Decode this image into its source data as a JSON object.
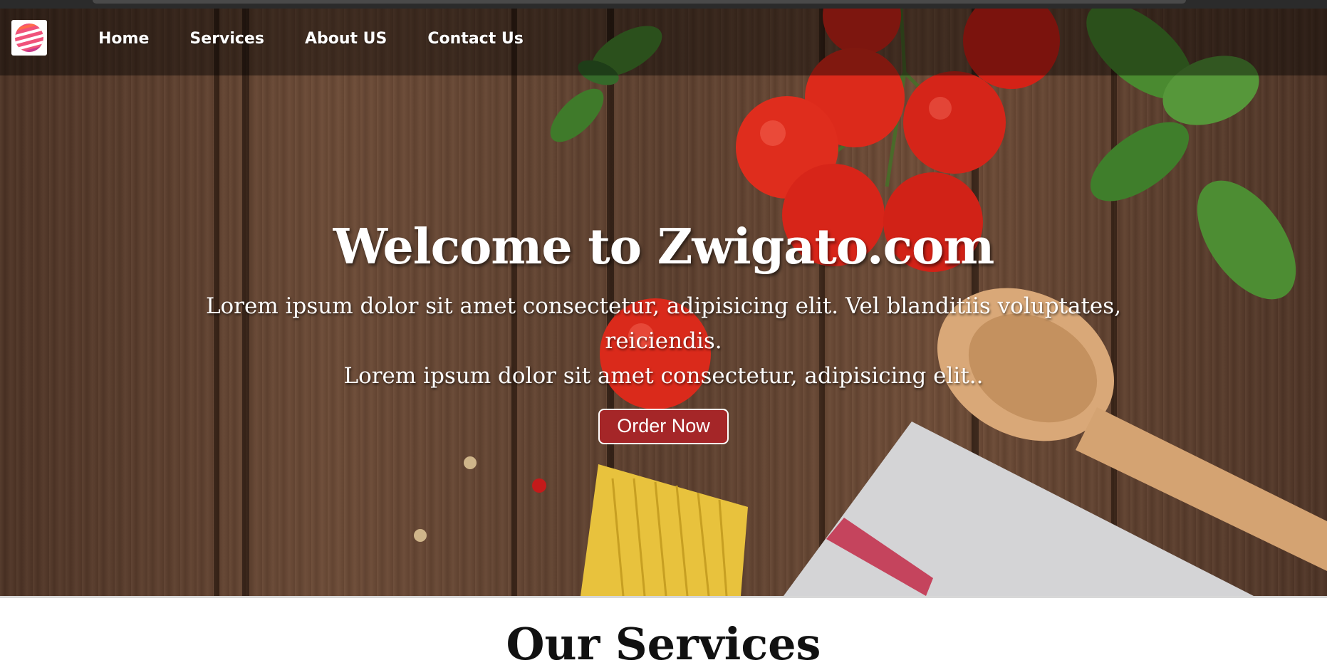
{
  "brand": {
    "logo_icon": "striped-globe-logo",
    "accent": "#e8365d"
  },
  "nav": {
    "items": [
      {
        "label": "Home"
      },
      {
        "label": "Services"
      },
      {
        "label": "About US"
      },
      {
        "label": "Contact Us"
      }
    ]
  },
  "hero": {
    "title": "Welcome to Zwigato.com",
    "description": "Lorem ipsum dolor sit amet consectetur, adipisicing elit. Vel blanditiis voluptates, reiciendis.",
    "description2": "Lorem ipsum dolor sit amet consectetur, adipisicing elit..",
    "button_label": "Order Now",
    "button_color": "#a52628",
    "background_image": "wooden-table-tomatoes-basil-pasta"
  },
  "services": {
    "heading": "Our Services"
  }
}
